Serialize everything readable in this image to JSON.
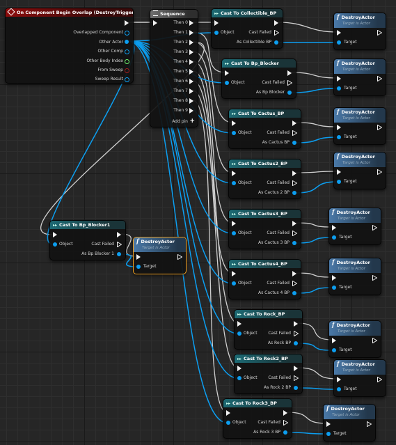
{
  "event": {
    "title": "On Component Begin Overlap (DestroyTrigger)",
    "pins": [
      "Overlapped Component",
      "Other Actor",
      "Other Comp",
      "Other Body Index",
      "From Sweep",
      "Sweep Result"
    ]
  },
  "sequence": {
    "title": "Sequence",
    "outputs": [
      "Then 0",
      "Then 1",
      "Then 2",
      "Then 3",
      "Then 4",
      "Then 5",
      "Then 6",
      "Then 7",
      "Then 8",
      "Then 9"
    ],
    "add_pin": "Add pin"
  },
  "cast_common": {
    "object": "Object",
    "cast_failed": "Cast Failed"
  },
  "destroy_common": {
    "title": "DestroyActor",
    "subtitle": "Target is Actor",
    "target": "Target",
    "icon": "function-icon"
  },
  "casts": [
    {
      "title": "Cast To Collectible_BP",
      "as": "As Collectible BP"
    },
    {
      "title": "Cast To Bp_Blocker",
      "as": "As Bp Blocker"
    },
    {
      "title": "Cast To Cactus_BP",
      "as": "As Cactus BP"
    },
    {
      "title": "Cast To Cactus2_BP",
      "as": "As Cactus 2 BP"
    },
    {
      "title": "Cast To Cactus3_BP",
      "as": "As Cactus 3 BP"
    },
    {
      "title": "Cast To Cactus4_BP",
      "as": "As Cactus 4 BP"
    },
    {
      "title": "Cast To Rock_BP",
      "as": "As Rock BP"
    },
    {
      "title": "Cast To Rock2_BP",
      "as": "As Rock 2 BP"
    },
    {
      "title": "Cast To Rock3_BP",
      "as": "As Rock 3 BP"
    },
    {
      "title": "Cast To Bp_Blocker1",
      "as": "As Bp Blocker 1"
    }
  ],
  "colors": {
    "exec": "#f2f2f2",
    "object_pin": "#0c9ef0",
    "wire_exec": "#d8d8d8",
    "selected": "#f0a020",
    "event_header": "#8c0c0c",
    "cast_header": "#1d6a74",
    "func_header": "#4a79a8"
  }
}
